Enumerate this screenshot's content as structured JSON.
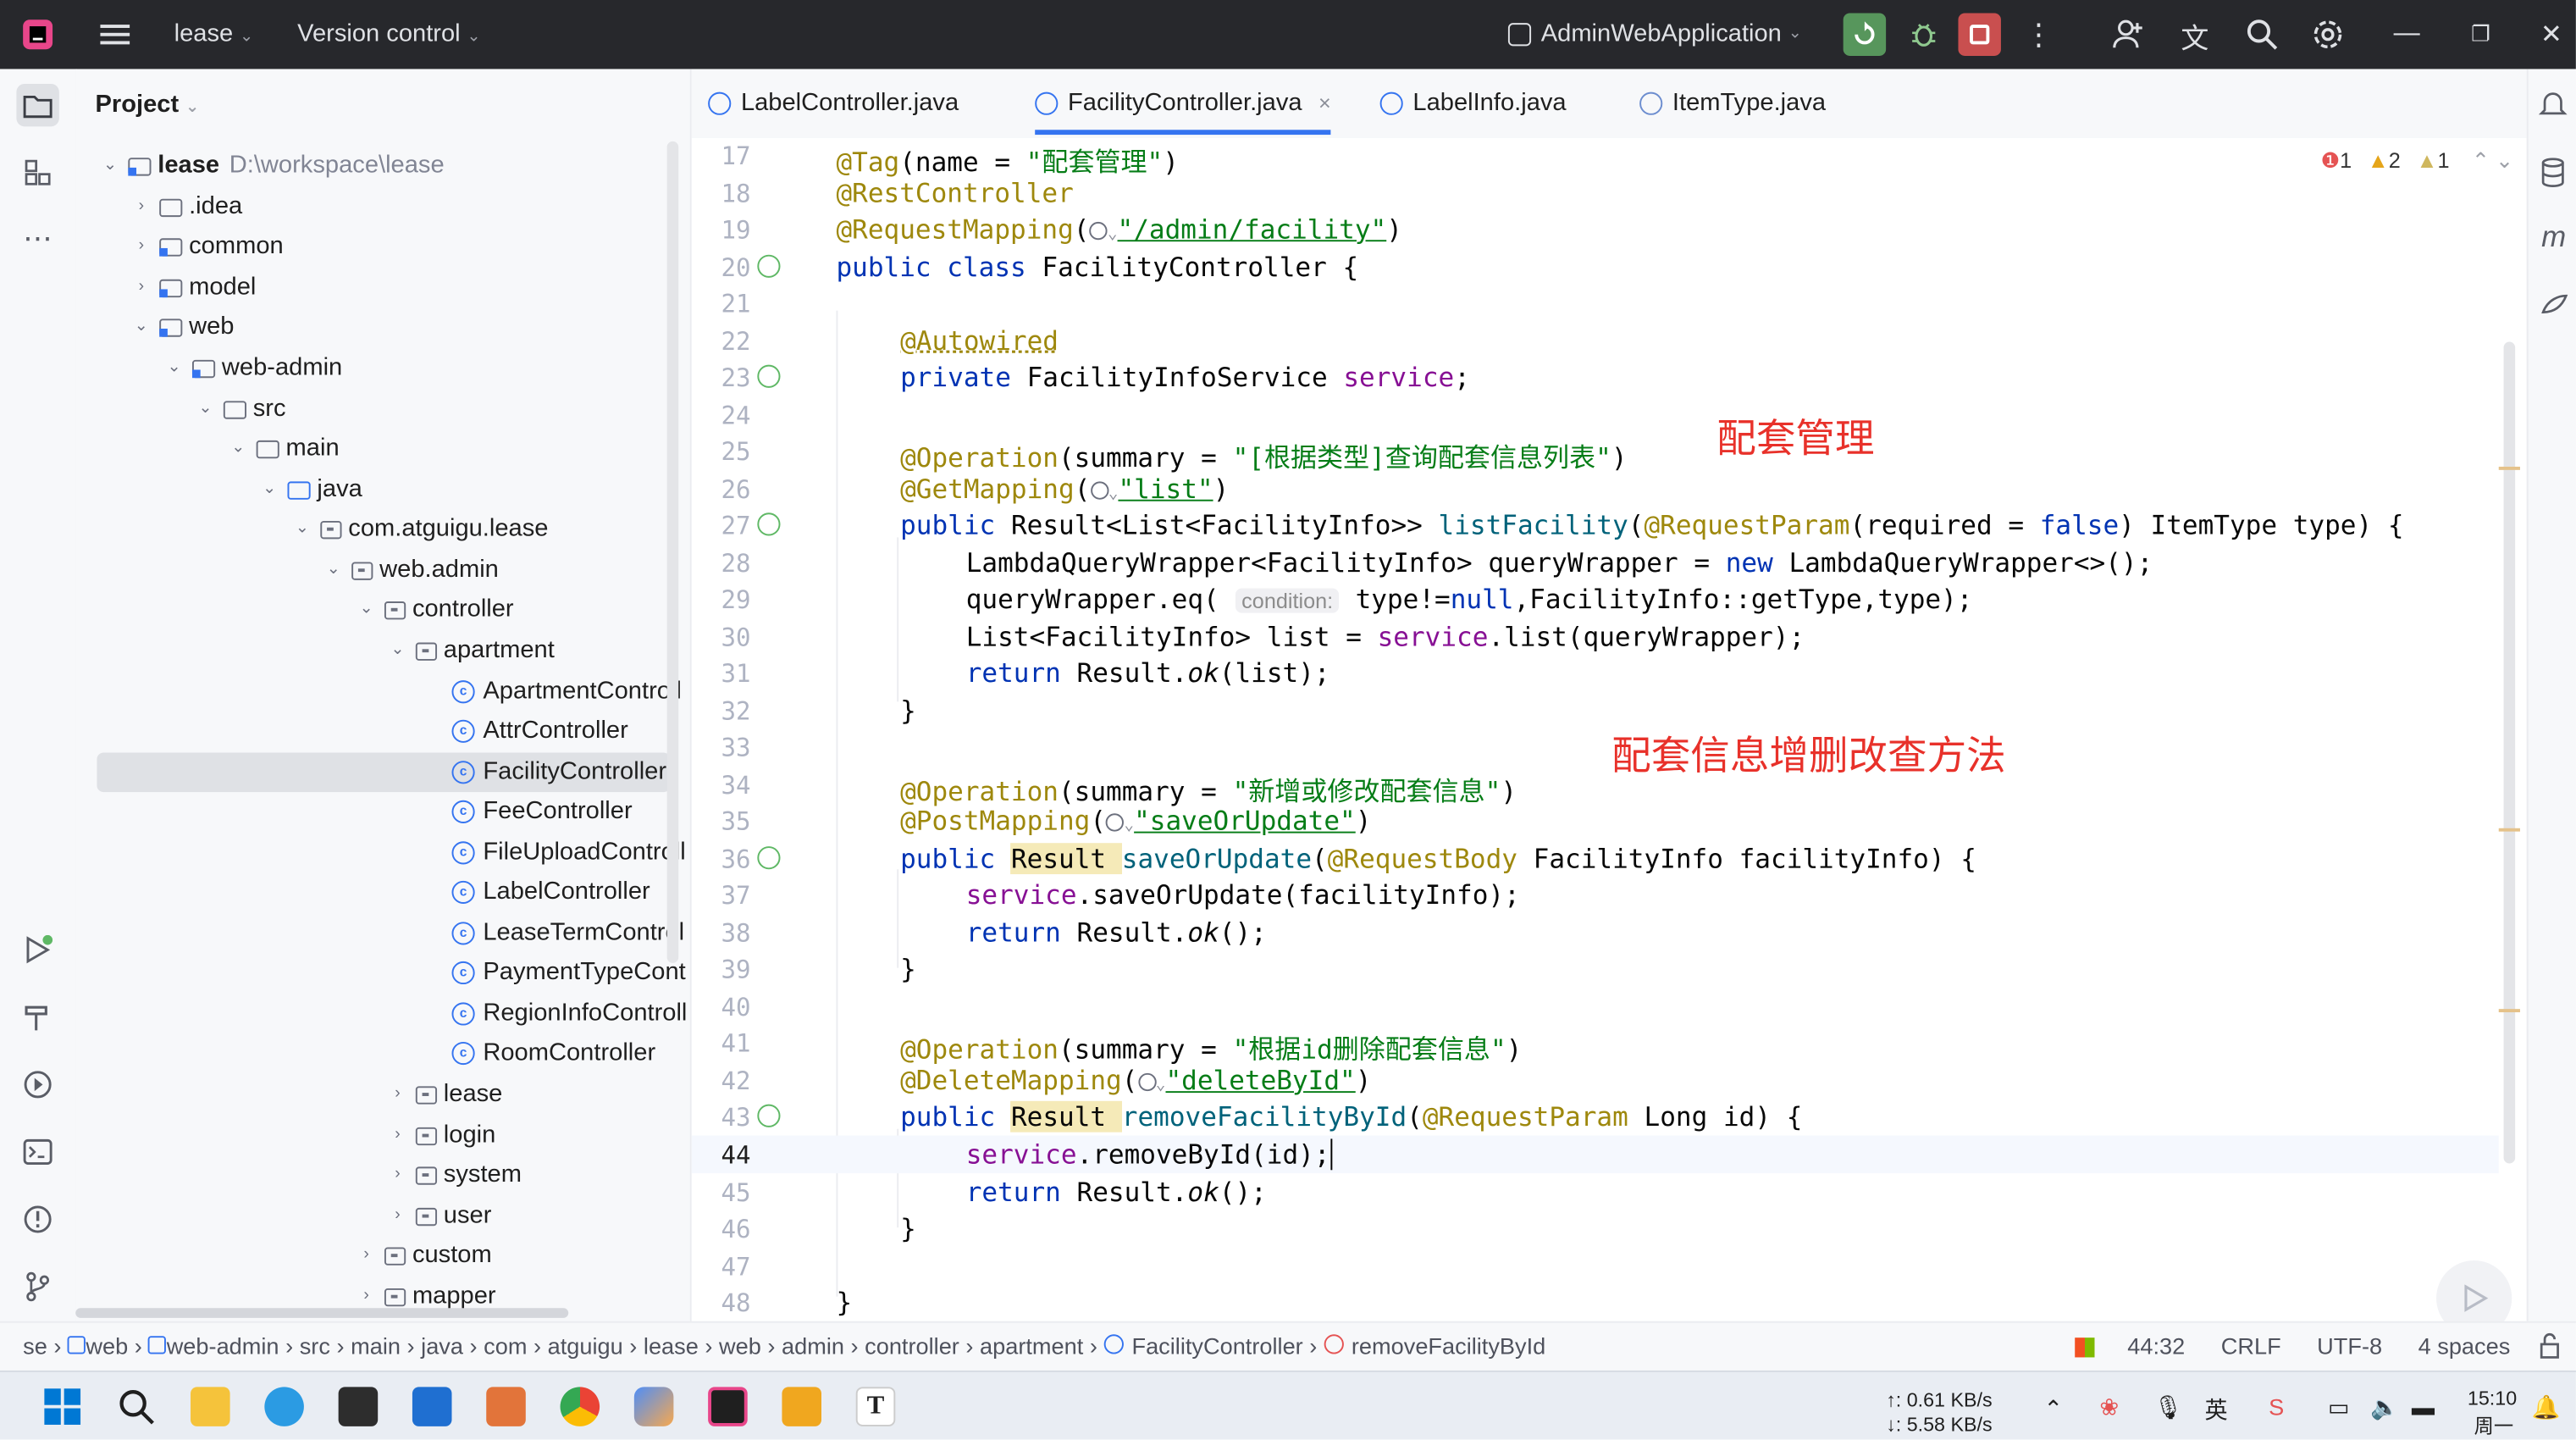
{
  "titlebar": {
    "project": "lease",
    "vcs": "Version control",
    "run_config": "AdminWebApplication"
  },
  "project_panel": {
    "title": "Project",
    "tree": [
      {
        "label": "lease",
        "path": "D:\\workspace\\lease",
        "kind": "module",
        "expanded": true
      },
      {
        "label": ".idea",
        "kind": "folder"
      },
      {
        "label": "common",
        "kind": "module"
      },
      {
        "label": "model",
        "kind": "module"
      },
      {
        "label": "web",
        "kind": "module",
        "expanded": true
      },
      {
        "label": "web-admin",
        "kind": "module",
        "expanded": true
      },
      {
        "label": "src",
        "kind": "folder",
        "expanded": true
      },
      {
        "label": "main",
        "kind": "folder",
        "expanded": true
      },
      {
        "label": "java",
        "kind": "folder",
        "expanded": true
      },
      {
        "label": "com.atguigu.lease",
        "kind": "package",
        "expanded": true
      },
      {
        "label": "web.admin",
        "kind": "package",
        "expanded": true
      },
      {
        "label": "controller",
        "kind": "package",
        "expanded": true
      },
      {
        "label": "apartment",
        "kind": "package",
        "expanded": true
      },
      {
        "label": "ApartmentControll",
        "kind": "class"
      },
      {
        "label": "AttrController",
        "kind": "class"
      },
      {
        "label": "FacilityController",
        "kind": "class",
        "selected": true
      },
      {
        "label": "FeeController",
        "kind": "class"
      },
      {
        "label": "FileUploadControll",
        "kind": "class"
      },
      {
        "label": "LabelController",
        "kind": "class"
      },
      {
        "label": "LeaseTermControl",
        "kind": "class"
      },
      {
        "label": "PaymentTypeCont",
        "kind": "class"
      },
      {
        "label": "RegionInfoControll",
        "kind": "class"
      },
      {
        "label": "RoomController",
        "kind": "class"
      },
      {
        "label": "lease",
        "kind": "package"
      },
      {
        "label": "login",
        "kind": "package"
      },
      {
        "label": "system",
        "kind": "package"
      },
      {
        "label": "user",
        "kind": "package"
      },
      {
        "label": "custom",
        "kind": "package"
      },
      {
        "label": "mapper",
        "kind": "package"
      }
    ]
  },
  "tabs": [
    {
      "label": "LabelController.java"
    },
    {
      "label": "FacilityController.java",
      "active": true,
      "close": "×"
    },
    {
      "label": "LabelInfo.java"
    },
    {
      "label": "ItemType.java"
    }
  ],
  "inspections": {
    "errors": "1",
    "warnings": "2",
    "weak": "1"
  },
  "code": {
    "l17": {
      "n": "17",
      "a": "@Tag",
      "b": "(name = ",
      "s": "\"配套管理\"",
      "c": ")"
    },
    "l18": {
      "n": "18",
      "a": "@RestController"
    },
    "l19": {
      "n": "19",
      "a": "@RequestMapping",
      "b": "(",
      "s": "\"/admin/facility\"",
      "c": ")"
    },
    "l20": {
      "n": "20",
      "k": "public class ",
      "t": "FacilityController {"
    },
    "l21": {
      "n": "21"
    },
    "l22": {
      "n": "22",
      "a": "@Autowired"
    },
    "l23": {
      "n": "23",
      "k": "private ",
      "t": "FacilityInfoService ",
      "f": "service",
      "e": ";"
    },
    "l24": {
      "n": "24"
    },
    "l25": {
      "n": "25",
      "a": "@Operation",
      "b": "(summary = ",
      "s": "\"[根据类型]查询配套信息列表\"",
      "c": ")"
    },
    "l26": {
      "n": "26",
      "a": "@GetMapping",
      "b": "(",
      "s": "\"list\"",
      "c": ")"
    },
    "l27": {
      "n": "27",
      "k": "public ",
      "t": "Result<List<FacilityInfo>> ",
      "m": "listFacility",
      "b": "(",
      "a": "@RequestParam",
      "b2": "(required = ",
      "k2": "false",
      "c": ") ItemType type) {"
    },
    "l28": {
      "n": "28",
      "t": "LambdaQueryWrapper<FacilityInfo> queryWrapper = ",
      "k": "new ",
      "c": "LambdaQueryWrapper<>();"
    },
    "l29": {
      "n": "29",
      "t": "queryWrapper.eq( ",
      "hint": "condition:",
      "c1": " type!=",
      "k": "null",
      "c": ",FacilityInfo::getType,type);"
    },
    "l30": {
      "n": "30",
      "t": "List<FacilityInfo> list = ",
      "f": "service",
      "c": ".list(queryWrapper);"
    },
    "l31": {
      "n": "31",
      "k": "return ",
      "t": "Result.",
      "i": "ok",
      "c": "(list);"
    },
    "l32": {
      "n": "32",
      "t": "}"
    },
    "l33": {
      "n": "33"
    },
    "l34": {
      "n": "34",
      "a": "@Operation",
      "b": "(summary = ",
      "s": "\"新增或修改配套信息\"",
      "c": ")"
    },
    "l35": {
      "n": "35",
      "a": "@PostMapping",
      "b": "(",
      "s": "\"saveOrUpdate\"",
      "c": ")"
    },
    "l36": {
      "n": "36",
      "k": "public ",
      "t": "Result ",
      "m": "saveOrUpdate",
      "b": "(",
      "a": "@RequestBody",
      "c": " FacilityInfo facilityInfo) {"
    },
    "l37": {
      "n": "37",
      "f": "service",
      "c": ".saveOrUpdate(facilityInfo);"
    },
    "l38": {
      "n": "38",
      "k": "return ",
      "t": "Result.",
      "i": "ok",
      "c": "();"
    },
    "l39": {
      "n": "39",
      "t": "}"
    },
    "l40": {
      "n": "40"
    },
    "l41": {
      "n": "41",
      "a": "@Operation",
      "b": "(summary = ",
      "s": "\"根据id删除配套信息\"",
      "c": ")"
    },
    "l42": {
      "n": "42",
      "a": "@DeleteMapping",
      "b": "(",
      "s": "\"deleteById\"",
      "c": ")"
    },
    "l43": {
      "n": "43",
      "k": "public ",
      "t": "Result ",
      "m": "removeFacilityById",
      "b": "(",
      "a": "@RequestParam",
      "c": " Long id) {"
    },
    "l44": {
      "n": "44",
      "f": "service",
      "c": ".removeById(id);"
    },
    "l45": {
      "n": "45",
      "k": "return ",
      "t": "Result.",
      "i": "ok",
      "c": "();"
    },
    "l46": {
      "n": "46",
      "t": "}"
    },
    "l47": {
      "n": "47"
    },
    "l48": {
      "n": "48",
      "t": "}"
    }
  },
  "overlay": {
    "title1": "配套管理",
    "title2": "配套信息增删改查方法"
  },
  "breadcrumbs": [
    "se",
    "web",
    "web-admin",
    "src",
    "main",
    "java",
    "com",
    "atguigu",
    "lease",
    "web",
    "admin",
    "controller",
    "apartment",
    "FacilityController",
    "removeFacilityById"
  ],
  "status": {
    "position": "44:32",
    "line_sep": "CRLF",
    "encoding": "UTF-8",
    "indent": "4 spaces"
  },
  "taskbar": {
    "net_up": "↑: 0.61 KB/s",
    "net_down": "↓: 5.58 KB/s",
    "time": "15:10",
    "day": "周一"
  },
  "colors": {
    "accent": "#3574f0",
    "title_bg": "#27282c",
    "annotation": "#e8312a"
  }
}
